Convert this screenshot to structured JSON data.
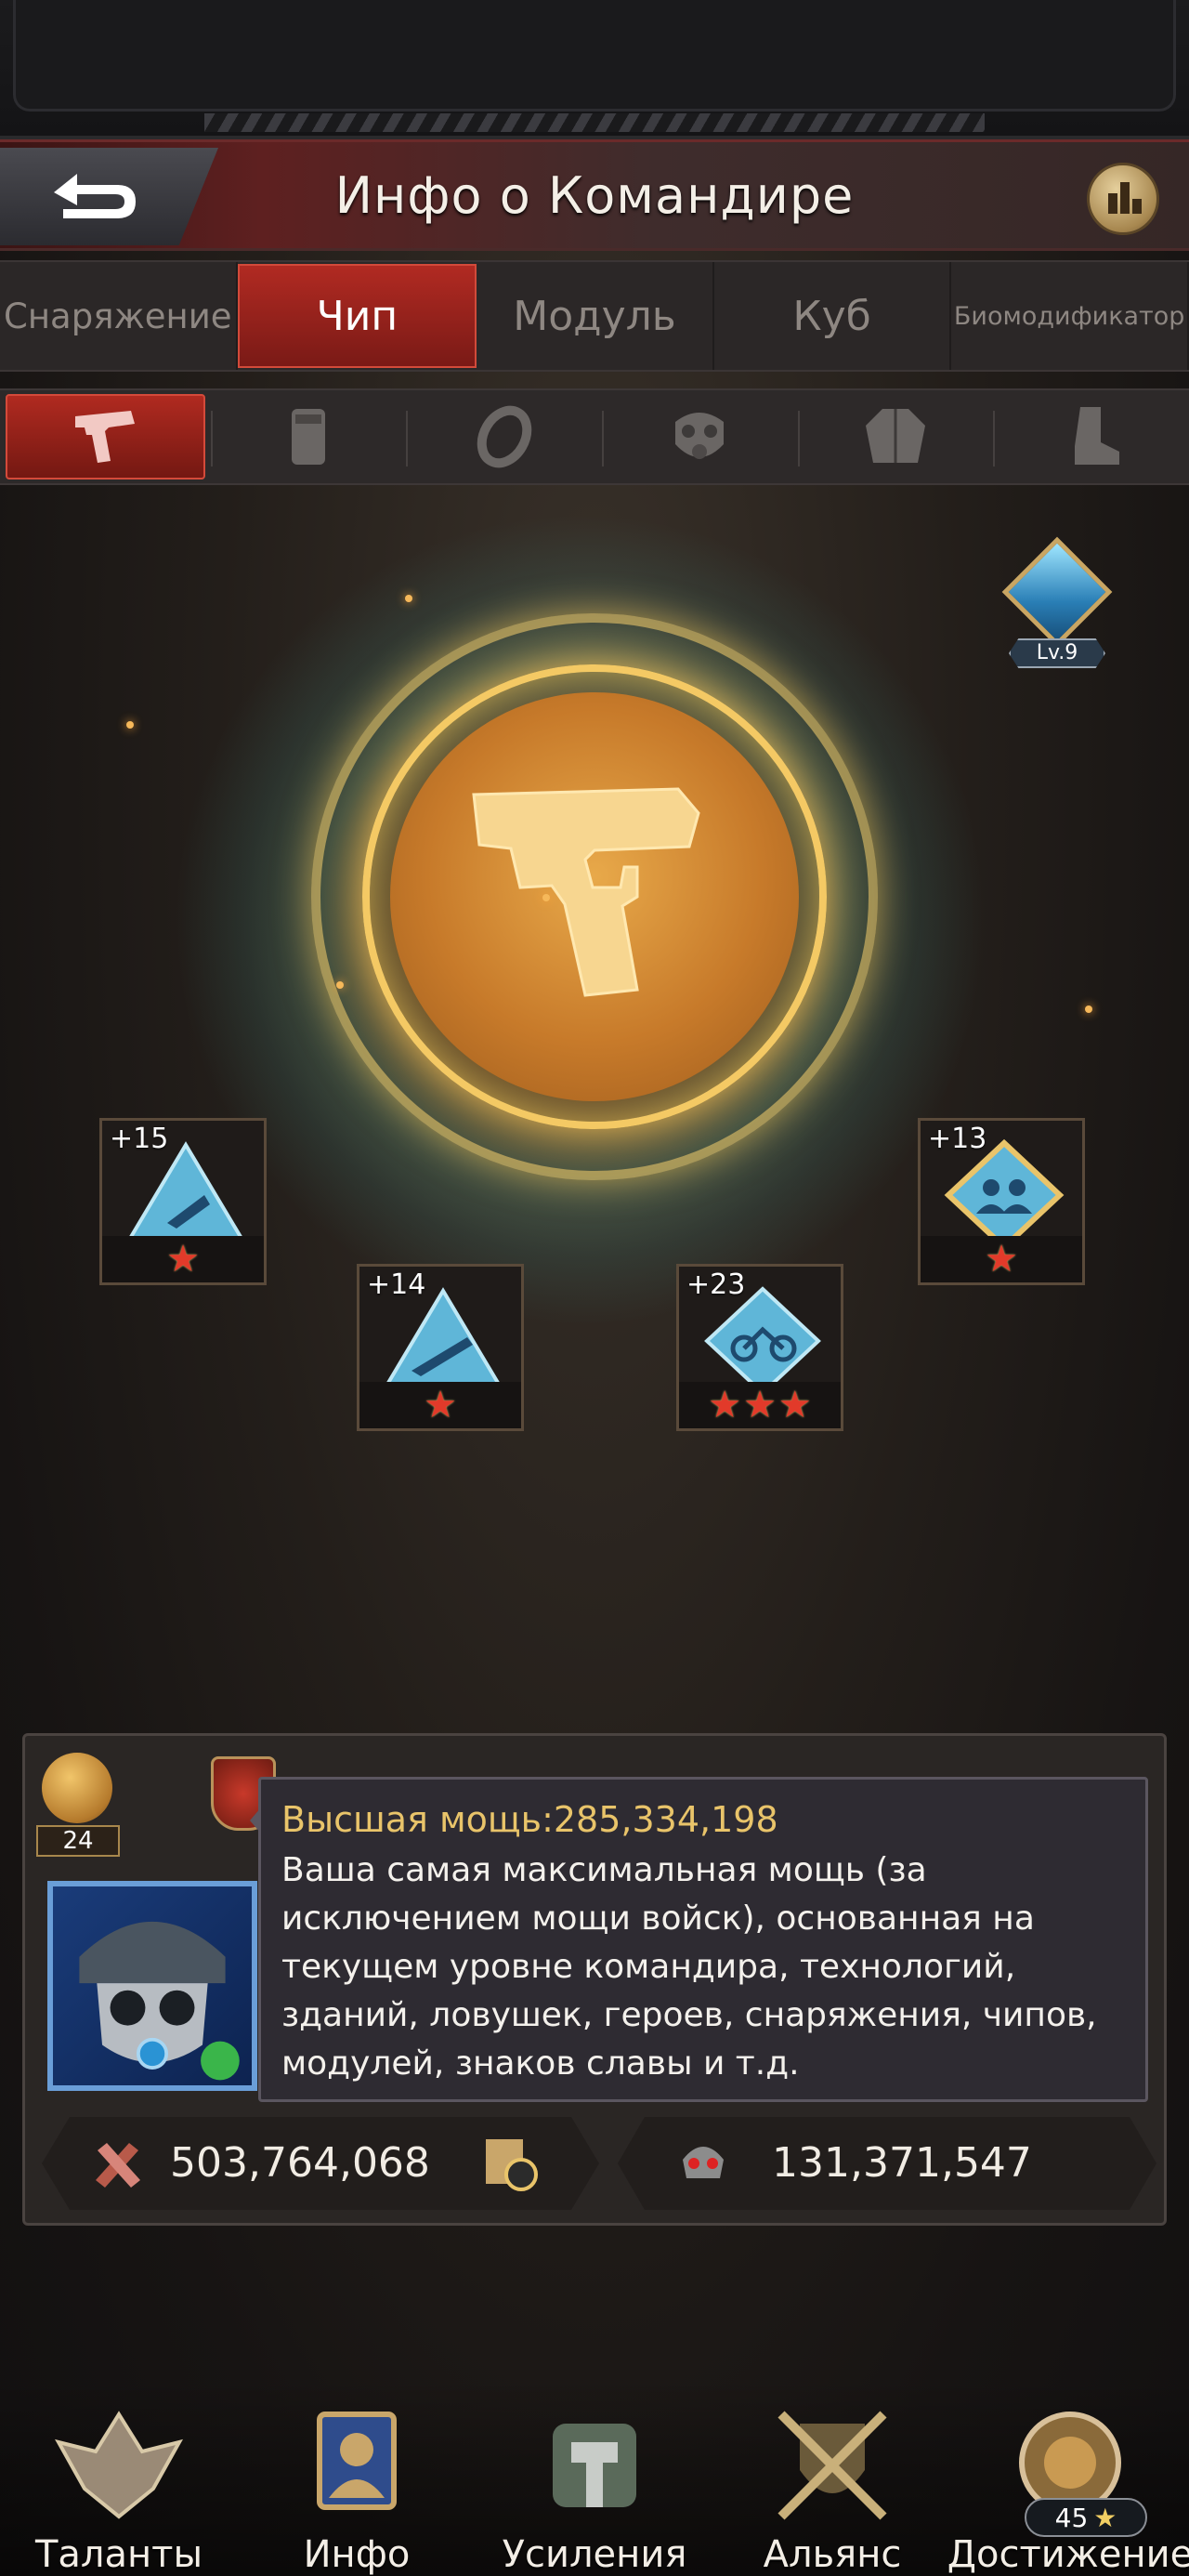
{
  "header": {
    "title": "Инфо о Командире"
  },
  "tabs": [
    {
      "label": "Снаряжение"
    },
    {
      "label": "Чип"
    },
    {
      "label": "Модуль"
    },
    {
      "label": "Куб"
    },
    {
      "label": "Биомодификатор"
    }
  ],
  "active_tab": "Чип",
  "equipment_slots": [
    "pistol-icon",
    "armor-plate-icon",
    "ring-icon",
    "gas-mask-icon",
    "jacket-icon",
    "boot-icon"
  ],
  "chip_level_badge": {
    "label": "Lv.9"
  },
  "chips": [
    {
      "bonus": "+15",
      "stars": 1
    },
    {
      "bonus": "+14",
      "stars": 1
    },
    {
      "bonus": "+23",
      "stars": 3
    },
    {
      "bonus": "+13",
      "stars": 1
    }
  ],
  "commander": {
    "medal_count": "24",
    "tooltip_title": "Высшая мощь:285,334,198",
    "tooltip_body": "Ваша самая максимальная мощь (за исключением мощи войск), основанная на текущем уровне командира, технологий, зданий, ловушек, героев, снаряжения, чипов, модулей, знаков славы и т.д.",
    "power": "503,764,068",
    "kills": "131,371,547"
  },
  "bottom_nav": [
    {
      "label": "Таланты"
    },
    {
      "label": "Инфо"
    },
    {
      "label": "Усиления"
    },
    {
      "label": "Альянс"
    },
    {
      "label": "Достижение",
      "badge": "45"
    }
  ],
  "colors": {
    "accent_red": "#b12a22",
    "gold": "#e9c46a",
    "star_red": "#e23a2a"
  }
}
